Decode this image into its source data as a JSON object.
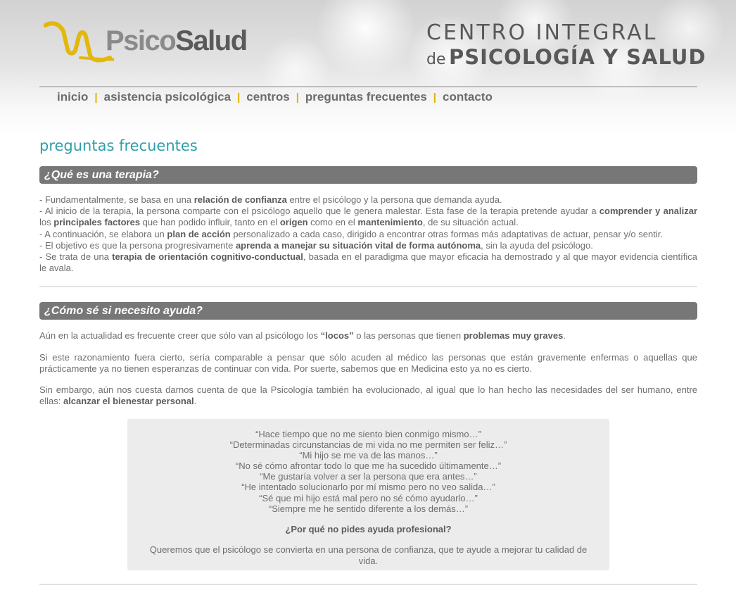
{
  "header": {
    "logo": {
      "psico": "Psico",
      "salud": "Salud"
    },
    "tagline": {
      "line1": "CENTRO INTEGRAL",
      "de": "de",
      "line2": "PSICOLOGÍA Y SALUD"
    }
  },
  "nav": {
    "items": [
      {
        "label": "inicio"
      },
      {
        "label": "asistencia psicológica"
      },
      {
        "label": "centros"
      },
      {
        "label": "preguntas frecuentes"
      },
      {
        "label": "contacto"
      }
    ],
    "separator": "|"
  },
  "page_title": "preguntas frecuentes",
  "sections": [
    {
      "title": "¿Qué es una terapia?",
      "items": [
        [
          "- Fundamentalmente, se basa en una ",
          "relación de confianza",
          " entre el psicólogo y la persona que demanda ayuda."
        ],
        [
          "- Al inicio de la terapia, la persona comparte con el psicólogo aquello que le genera malestar. Esta fase de la terapia pretende ayudar a ",
          "comprender y analizar",
          " los ",
          "principales factores",
          " que han podido influir, tanto en el ",
          "origen",
          " como en el ",
          "mantenimiento",
          ", de su situación actual."
        ],
        [
          "- A continuación, se elabora un ",
          "plan de acción",
          " personalizado a cada caso, dirigido a encontrar otras formas más adaptativas de actuar, pensar y/o sentir."
        ],
        [
          "- El objetivo es que la persona progresivamente ",
          "aprenda a manejar su situación vital de forma autónoma",
          ", sin la ayuda del psicólogo."
        ],
        [
          "- Se trata de una ",
          "terapia de orientación cognitivo-conductual",
          ", basada en el paradigma que mayor eficacia ha demostrado y al que mayor evidencia científica le avala."
        ]
      ]
    },
    {
      "title": "¿Cómo sé si necesito ayuda?",
      "paragraphs": [
        [
          "Aún en la actualidad es frecuente creer que sólo van al psicólogo los ",
          "“locos”",
          " o las personas que tienen ",
          "problemas muy graves",
          "."
        ],
        [
          "Si este razonamiento fuera cierto, sería comparable a pensar que sólo acuden al médico las personas que están gravemente enfermas o aquellas que prácticamente ya no tienen esperanzas de continuar con vida. Por suerte, sabemos que en Medicina esto ya no es cierto."
        ],
        [
          "Sin embargo, aún nos cuesta darnos cuenta de que la Psicología también ha evolucionado, al igual que lo han hecho las necesidades del ser humano, entre ellas: ",
          "alcanzar el bienestar personal",
          "."
        ]
      ],
      "quotes": [
        "“Hace tiempo que no me siento bien conmigo mismo…”",
        "“Determinadas circunstancias de mi vida no me permiten ser feliz…”",
        "“Mi hijo se me va de las manos…”",
        "“No sé cómo afrontar todo lo que me ha sucedido últimamente…”",
        "“Me gustaría volver a ser la persona que era antes…”",
        "“He intentado solucionarlo por mí mismo pero no veo salida…”",
        "“Sé que mi hijo está mal pero no sé cómo ayudarlo…”",
        "“Siempre me he sentido diferente a los demás…”"
      ],
      "question": "¿Por qué no pides ayuda profesional?",
      "answer": "Queremos que el psicólogo se convierta en una persona de confianza, que te ayude a mejorar tu calidad de vida."
    }
  ],
  "colors": {
    "accent_teal": "#2f9eaa",
    "logo_yellow": "#e2b80c",
    "section_bar": "#777777",
    "nav_separator": "#e0b000"
  }
}
